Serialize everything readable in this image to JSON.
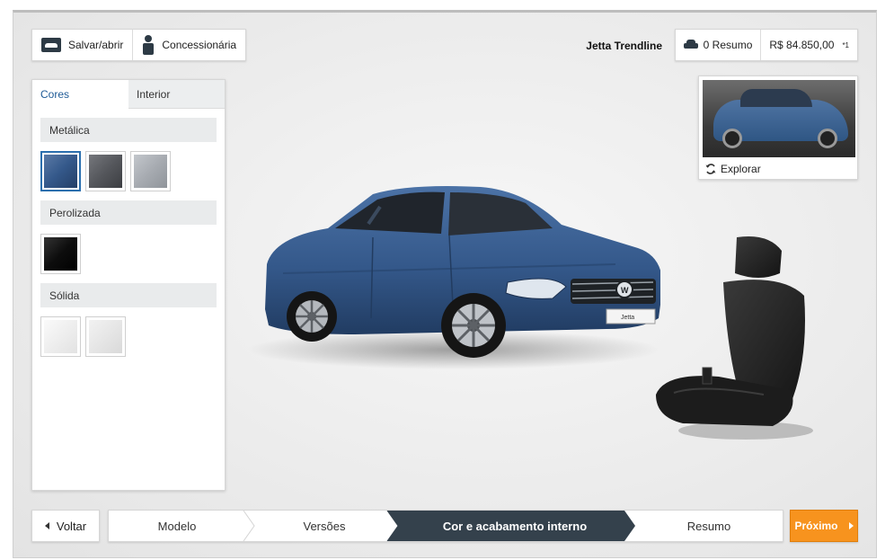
{
  "toolbar": {
    "save_label": "Salvar/abrir",
    "dealer_label": "Concessionária"
  },
  "header": {
    "model_name": "Jetta Trendline",
    "summary_label": "0 Resumo",
    "price": "R$ 84.850,00",
    "price_note": "*1"
  },
  "panel": {
    "tabs": [
      {
        "label": "Cores",
        "active": true
      },
      {
        "label": "Interior",
        "active": false
      }
    ],
    "sections": [
      {
        "label": "Metálica",
        "swatches": [
          "#3d5f8c",
          "#55575c",
          "#a7abb1"
        ],
        "selected": 0
      },
      {
        "label": "Perolizada",
        "swatches": [
          "#111111"
        ]
      },
      {
        "label": "Sólida",
        "swatches": [
          "#f1f1f1",
          "#e9e9e9"
        ]
      }
    ]
  },
  "thumbnail": {
    "explore_label": "Explorar"
  },
  "nav": {
    "back_label": "Voltar",
    "next_label": "Próximo",
    "steps": [
      {
        "label": "Modelo",
        "active": false
      },
      {
        "label": "Versões",
        "active": false
      },
      {
        "label": "Cor e acabamento interno",
        "active": true
      },
      {
        "label": "Resumo",
        "active": false
      }
    ]
  },
  "car": {
    "plate": "Jetta",
    "body_color": "#34588a"
  },
  "colors": {
    "accent": "#f7931e",
    "active_step": "#34414c",
    "selected_border": "#2b6fae",
    "tab_active_text": "#1e5a96"
  }
}
